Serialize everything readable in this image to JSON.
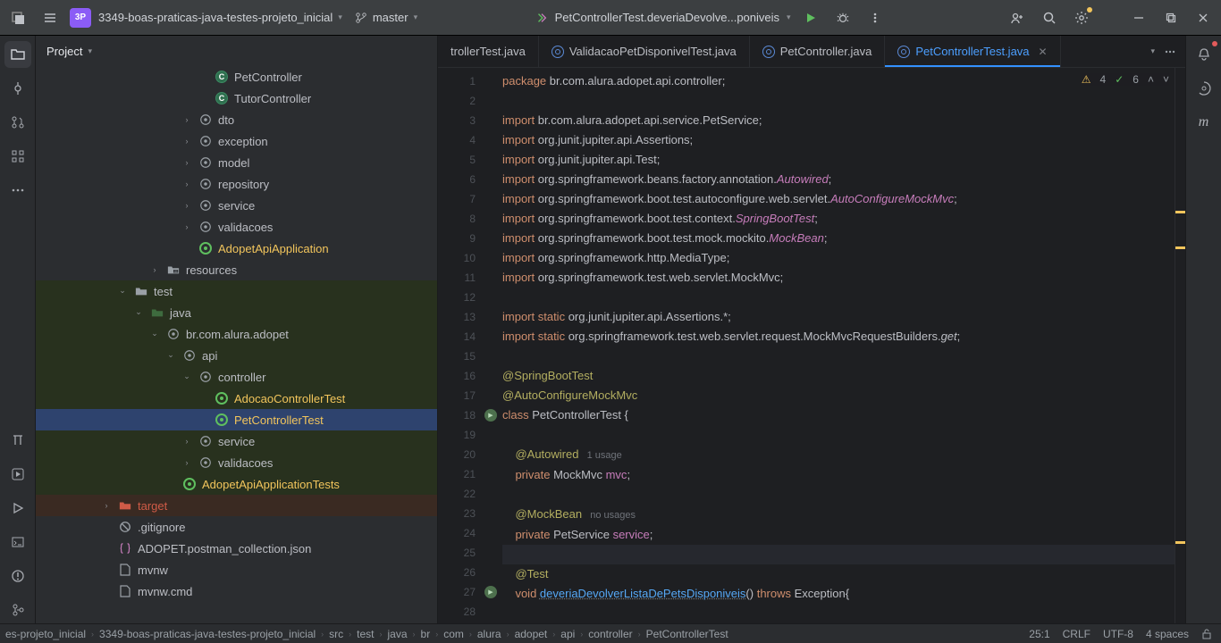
{
  "titlebar": {
    "project_badge": "3P",
    "project_name": "3349-boas-praticas-java-testes-projeto_inicial",
    "branch": "master",
    "run_config": "PetControllerTest.deveriaDevolve...poniveis"
  },
  "left_rail": {
    "tool": "Project"
  },
  "side_header": "Project",
  "tree": [
    {
      "depth": 10,
      "icon": "class",
      "label": "PetController",
      "hl": "",
      "exp": ""
    },
    {
      "depth": 10,
      "icon": "class",
      "label": "TutorController",
      "hl": "",
      "exp": ""
    },
    {
      "depth": 9,
      "icon": "pkg",
      "label": "dto",
      "hl": "",
      "exp": "›"
    },
    {
      "depth": 9,
      "icon": "pkg",
      "label": "exception",
      "hl": "",
      "exp": "›"
    },
    {
      "depth": 9,
      "icon": "pkg",
      "label": "model",
      "hl": "",
      "exp": "›"
    },
    {
      "depth": 9,
      "icon": "pkg",
      "label": "repository",
      "hl": "",
      "exp": "›"
    },
    {
      "depth": 9,
      "icon": "pkg",
      "label": "service",
      "hl": "",
      "exp": "›"
    },
    {
      "depth": 9,
      "icon": "pkg",
      "label": "validacoes",
      "hl": "",
      "exp": "›"
    },
    {
      "depth": 9,
      "icon": "boot",
      "label": "AdopetApiApplication",
      "hl": "",
      "exp": "",
      "amber": true
    },
    {
      "depth": 7,
      "icon": "folder-res",
      "label": "resources",
      "hl": "",
      "exp": "›"
    },
    {
      "depth": 5,
      "icon": "folder",
      "label": "test",
      "hl": "green",
      "exp": "⌄"
    },
    {
      "depth": 6,
      "icon": "folder-test",
      "label": "java",
      "hl": "green",
      "exp": "⌄"
    },
    {
      "depth": 7,
      "icon": "pkg",
      "label": "br.com.alura.adopet",
      "hl": "green",
      "exp": "⌄"
    },
    {
      "depth": 8,
      "icon": "pkg",
      "label": "api",
      "hl": "green",
      "exp": "⌄"
    },
    {
      "depth": 9,
      "icon": "pkg",
      "label": "controller",
      "hl": "green",
      "exp": "⌄"
    },
    {
      "depth": 10,
      "icon": "boot",
      "label": "AdocaoControllerTest",
      "hl": "green",
      "exp": "",
      "amber": true
    },
    {
      "depth": 10,
      "icon": "boot",
      "label": "PetControllerTest",
      "hl": "sel",
      "exp": "",
      "amber": true
    },
    {
      "depth": 9,
      "icon": "pkg",
      "label": "service",
      "hl": "green",
      "exp": "›"
    },
    {
      "depth": 9,
      "icon": "pkg",
      "label": "validacoes",
      "hl": "green",
      "exp": "›"
    },
    {
      "depth": 8,
      "icon": "boot",
      "label": "AdopetApiApplicationTests",
      "hl": "green",
      "exp": "",
      "amber": true
    },
    {
      "depth": 4,
      "icon": "folder-red",
      "label": "target",
      "hl": "red",
      "exp": "›"
    },
    {
      "depth": 4,
      "icon": "ignore",
      "label": ".gitignore",
      "hl": "",
      "exp": ""
    },
    {
      "depth": 4,
      "icon": "json",
      "label": "ADOPET.postman_collection.json",
      "hl": "",
      "exp": ""
    },
    {
      "depth": 4,
      "icon": "file",
      "label": "mvnw",
      "hl": "",
      "exp": ""
    },
    {
      "depth": 4,
      "icon": "file",
      "label": "mvnw.cmd",
      "hl": "",
      "exp": ""
    }
  ],
  "tabs": [
    {
      "label": "trollerTest.java",
      "sel": false,
      "trunc": true
    },
    {
      "label": "ValidacaoPetDisponivelTest.java",
      "sel": false
    },
    {
      "label": "PetController.java",
      "sel": false
    },
    {
      "label": "PetControllerTest.java",
      "sel": true
    }
  ],
  "inspection": {
    "warnings": "4",
    "ok": "6"
  },
  "code": {
    "start_line": 1,
    "lines": [
      {
        "t": [
          {
            "c": "kw",
            "s": "package "
          },
          {
            "c": "",
            "s": "br.com.alura.adopet.api.controller;"
          }
        ]
      },
      {
        "t": []
      },
      {
        "t": [
          {
            "c": "kw",
            "s": "import "
          },
          {
            "c": "",
            "s": "br.com.alura.adopet.api.service.PetService;"
          }
        ]
      },
      {
        "t": [
          {
            "c": "kw",
            "s": "import "
          },
          {
            "c": "",
            "s": "org.junit.jupiter.api.Assertions;"
          }
        ]
      },
      {
        "t": [
          {
            "c": "kw",
            "s": "import "
          },
          {
            "c": "",
            "s": "org.junit.jupiter.api.Test;"
          }
        ]
      },
      {
        "t": [
          {
            "c": "kw",
            "s": "import "
          },
          {
            "c": "",
            "s": "org.springframework.beans.factory.annotation."
          },
          {
            "c": "imp-cls",
            "s": "Autowired"
          },
          {
            "c": "",
            "s": ";"
          }
        ]
      },
      {
        "t": [
          {
            "c": "kw",
            "s": "import "
          },
          {
            "c": "",
            "s": "org.springframework.boot.test.autoconfigure.web.servlet."
          },
          {
            "c": "imp-cls",
            "s": "AutoConfigureMockMvc"
          },
          {
            "c": "",
            "s": ";"
          }
        ]
      },
      {
        "t": [
          {
            "c": "kw",
            "s": "import "
          },
          {
            "c": "",
            "s": "org.springframework.boot.test.context."
          },
          {
            "c": "imp-cls",
            "s": "SpringBootTest"
          },
          {
            "c": "",
            "s": ";"
          }
        ]
      },
      {
        "t": [
          {
            "c": "kw",
            "s": "import "
          },
          {
            "c": "",
            "s": "org.springframework.boot.test.mock.mockito."
          },
          {
            "c": "imp-cls",
            "s": "MockBean"
          },
          {
            "c": "",
            "s": ";"
          }
        ]
      },
      {
        "t": [
          {
            "c": "kw",
            "s": "import "
          },
          {
            "c": "",
            "s": "org.springframework.http.MediaType;"
          }
        ]
      },
      {
        "t": [
          {
            "c": "kw",
            "s": "import "
          },
          {
            "c": "",
            "s": "org.springframework.test.web.servlet.MockMvc;"
          }
        ]
      },
      {
        "t": []
      },
      {
        "t": [
          {
            "c": "kw",
            "s": "import static "
          },
          {
            "c": "",
            "s": "org.junit.jupiter.api.Assertions.*;"
          }
        ]
      },
      {
        "t": [
          {
            "c": "kw",
            "s": "import static "
          },
          {
            "c": "",
            "s": "org.springframework.test.web.servlet.request.MockMvcRequestBuilders."
          },
          {
            "c": "callItalic",
            "s": "get"
          },
          {
            "c": "",
            "s": ";"
          }
        ]
      },
      {
        "t": []
      },
      {
        "t": [
          {
            "c": "ann",
            "s": "@SpringBootTest"
          }
        ]
      },
      {
        "t": [
          {
            "c": "ann",
            "s": "@AutoConfigureMockMvc"
          }
        ]
      },
      {
        "t": [
          {
            "c": "kw",
            "s": "class "
          },
          {
            "c": "",
            "s": "PetControllerTest {"
          }
        ],
        "run": true
      },
      {
        "t": []
      },
      {
        "t": [
          {
            "c": "",
            "s": "    "
          },
          {
            "c": "ann",
            "s": "@Autowired"
          },
          {
            "c": "hint",
            "s": "   1 usage"
          }
        ]
      },
      {
        "t": [
          {
            "c": "",
            "s": "    "
          },
          {
            "c": "kw",
            "s": "private "
          },
          {
            "c": "",
            "s": "MockMvc "
          },
          {
            "c": "field",
            "s": "mvc"
          },
          {
            "c": "",
            "s": ";"
          }
        ]
      },
      {
        "t": []
      },
      {
        "t": [
          {
            "c": "",
            "s": "    "
          },
          {
            "c": "ann",
            "s": "@MockBean"
          },
          {
            "c": "hint",
            "s": "   no usages"
          }
        ]
      },
      {
        "t": [
          {
            "c": "",
            "s": "    "
          },
          {
            "c": "kw",
            "s": "private "
          },
          {
            "c": "",
            "s": "PetService "
          },
          {
            "c": "field",
            "s": "service"
          },
          {
            "c": "",
            "s": ";"
          }
        ]
      },
      {
        "t": [],
        "caret": true
      },
      {
        "t": [
          {
            "c": "",
            "s": "    "
          },
          {
            "c": "ann",
            "s": "@Test"
          }
        ]
      },
      {
        "t": [
          {
            "c": "",
            "s": "    "
          },
          {
            "c": "kw",
            "s": "void "
          },
          {
            "c": "method under",
            "s": "deveriaDevolverListaDePetsDisponiveis"
          },
          {
            "c": "",
            "s": "() "
          },
          {
            "c": "kw",
            "s": "throws "
          },
          {
            "c": "",
            "s": "Exception{"
          }
        ],
        "run": true
      },
      {
        "t": []
      }
    ]
  },
  "breadcrumb": [
    "es-projeto_inicial",
    "3349-boas-praticas-java-testes-projeto_inicial",
    "src",
    "test",
    "java",
    "br",
    "com",
    "alura",
    "adopet",
    "api",
    "controller",
    "PetControllerTest"
  ],
  "status": {
    "pos": "25:1",
    "eol": "CRLF",
    "enc": "UTF-8",
    "indent": "4 spaces"
  }
}
